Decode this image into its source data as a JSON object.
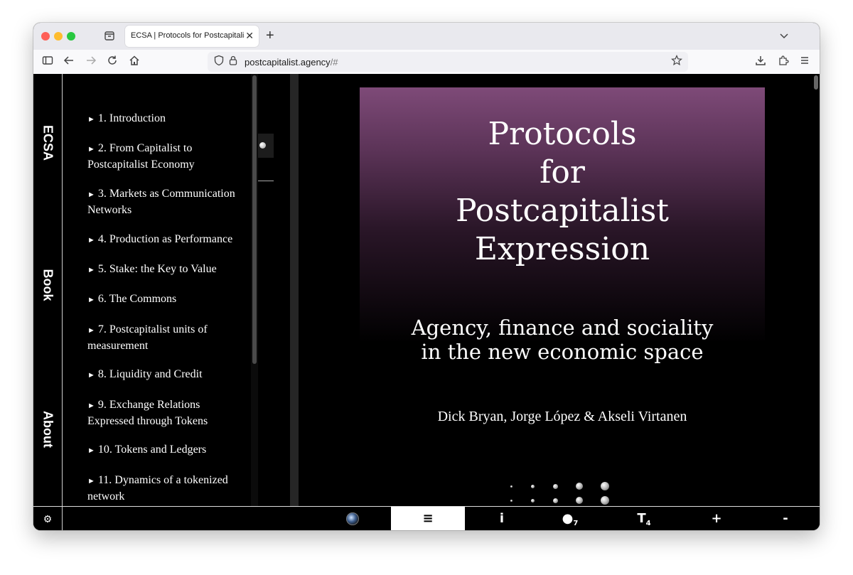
{
  "browser": {
    "tab_title": "ECSA | Protocols for Postcapitalist E",
    "tab_close": "✕",
    "new_tab": "+",
    "url_domain": "postcapitalist.agency",
    "url_hash": "/#"
  },
  "site": {
    "rail": [
      "ECSA",
      "Book",
      "About"
    ],
    "toc": [
      "1. Introduction",
      "2. From Capitalist to Postcapitalist Economy",
      "3. Markets as Communication Networks",
      "4. Production as Performance",
      "5. Stake: the Key to Value",
      "6. The Commons",
      "7. Postcapitalist units of measurement",
      "8. Liquidity and Credit",
      "9. Exchange Relations Expressed through Tokens",
      "10. Tokens and Ledgers",
      "11. Dynamics of a tokenized network"
    ],
    "toc_arrow": "►"
  },
  "cover": {
    "title_lines": [
      "Protocols",
      "for",
      "Postcapitalist",
      "Expression"
    ],
    "subtitle_lines": [
      "Agency, finance and sociality",
      "in the new economic space"
    ],
    "authors": "Dick Bryan, Jorge López & Akseli Virtanen"
  },
  "toolbar": {
    "settings_icon": "⚙",
    "menu": "≡",
    "info": "i",
    "dot": "●",
    "dot_sub": "7",
    "text": "T",
    "text_sub": "4",
    "plus": "+",
    "minus": "-"
  }
}
